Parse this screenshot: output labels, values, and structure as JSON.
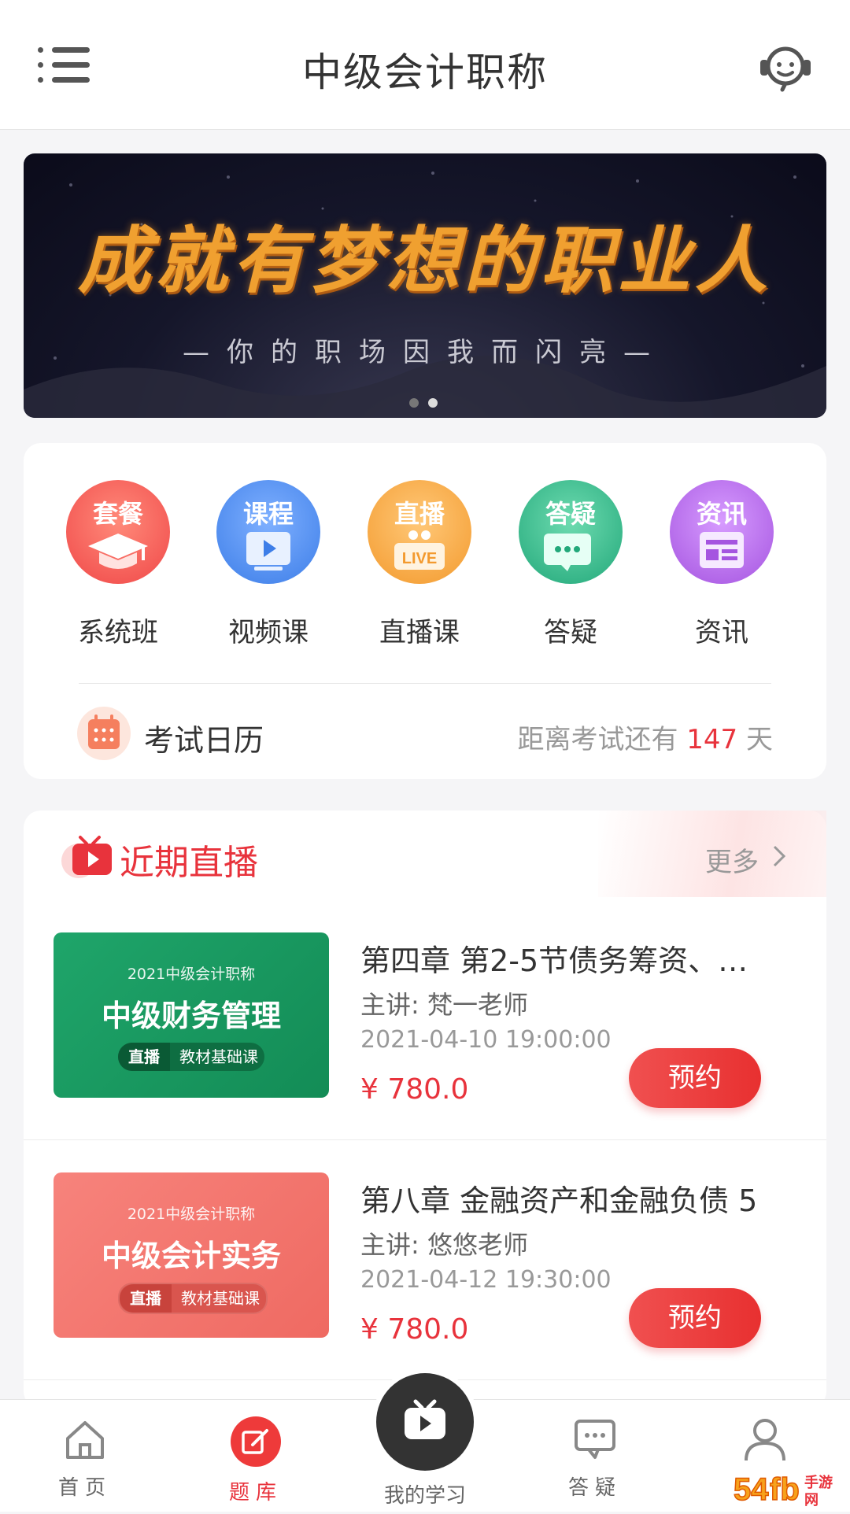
{
  "header": {
    "title": "中级会计职称",
    "menu_icon": "menu-icon",
    "service_icon": "customer-service-icon"
  },
  "banner": {
    "title": "成就有梦想的职业人",
    "subtitle": "—你的职场因我而闪亮—",
    "page_count": 2,
    "active_page": 1
  },
  "categories": [
    {
      "badge": "套餐",
      "label": "系统班",
      "icon": "graduation-cap-icon",
      "color": "#f25a5a"
    },
    {
      "badge": "课程",
      "label": "视频课",
      "icon": "video-play-icon",
      "color": "#4f8ff0"
    },
    {
      "badge": "直播",
      "label": "直播课",
      "icon": "live-icon",
      "color": "#f6a740"
    },
    {
      "badge": "答疑",
      "label": "答疑",
      "icon": "chat-bubble-icon",
      "color": "#2fba8a"
    },
    {
      "badge": "资讯",
      "label": "资讯",
      "icon": "news-icon",
      "color": "#b66ae8"
    }
  ],
  "exam_calendar": {
    "label": "考试日历",
    "countdown_prefix": "距离考试还有",
    "days": "147",
    "countdown_suffix": "天"
  },
  "live_section": {
    "title": "近期直播",
    "more_label": "更多"
  },
  "courses": [
    {
      "thumb": {
        "year": "2021中级会计职称",
        "name": "中级财务管理",
        "tag1": "直播",
        "tag2": "教材基础课",
        "color": "#1a9a62"
      },
      "title": "第四章 第2-5节债务筹资、…",
      "teacher": "主讲: 梵一老师",
      "date": "2021-04-10 19:00:00",
      "price": "¥ 780.0",
      "button": "预约"
    },
    {
      "thumb": {
        "year": "2021中级会计职称",
        "name": "中级会计实务",
        "tag1": "直播",
        "tag2": "教材基础课",
        "color": "#f2706a"
      },
      "title": "第八章 金融资产和金融负债 5",
      "teacher": "主讲: 悠悠老师",
      "date": "2021-04-12 19:30:00",
      "price": "¥ 780.0",
      "button": "预约"
    }
  ],
  "tabbar": [
    {
      "label": "首页",
      "icon": "home-icon"
    },
    {
      "label": "题库",
      "icon": "edit-icon",
      "active": true
    },
    {
      "label": "我的学习",
      "icon": "tv-play-icon",
      "center": true
    },
    {
      "label": "答疑",
      "icon": "message-icon"
    },
    {
      "label": "",
      "icon": "user-icon"
    }
  ],
  "watermark": "54fb手游网"
}
